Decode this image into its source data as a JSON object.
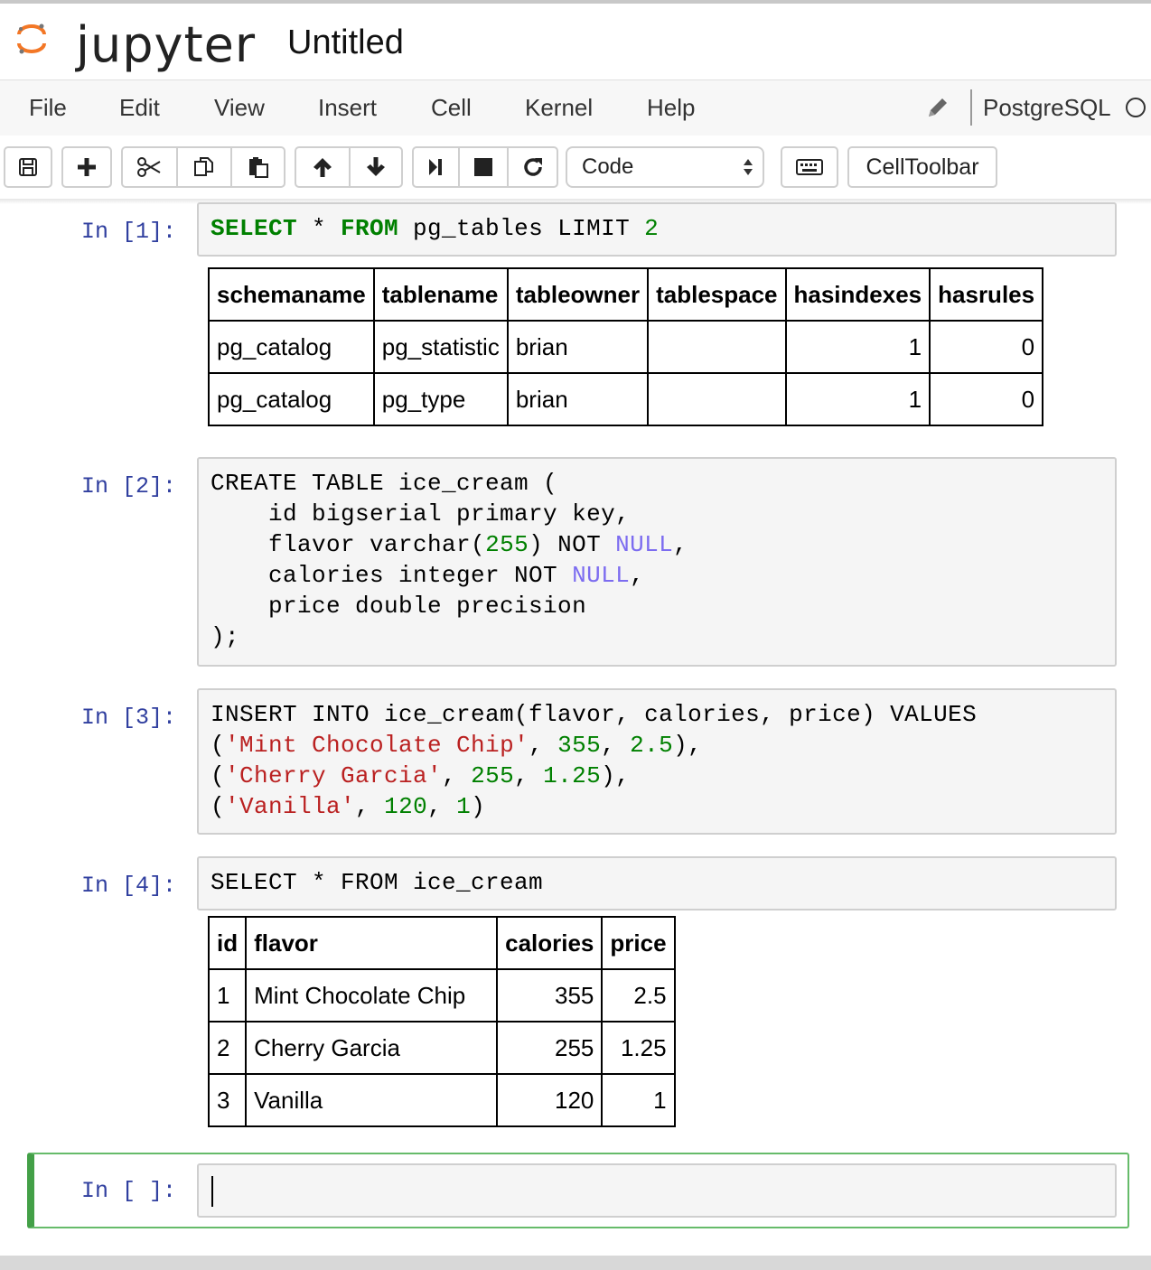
{
  "header": {
    "logo_text": "jupyter",
    "notebook_name": "Untitled"
  },
  "menubar": {
    "items": [
      "File",
      "Edit",
      "View",
      "Insert",
      "Cell",
      "Kernel",
      "Help"
    ],
    "kernel_name": "PostgreSQL",
    "edit_icon": "pencil-icon",
    "kernel_indicator_icon": "kernel-idle-circle-icon"
  },
  "toolbar": {
    "buttons": [
      "save-icon",
      "plus-icon",
      "cut-icon",
      "copy-icon",
      "paste-icon",
      "arrow-up-icon",
      "arrow-down-icon",
      "run-icon",
      "stop-icon",
      "restart-icon",
      "keyboard-icon"
    ],
    "cell_type": "Code",
    "celltoolbar_label": "CellToolbar"
  },
  "cells": [
    {
      "prompt": "In [1]:",
      "code": "SELECT * FROM pg_tables LIMIT 2",
      "output_table": {
        "columns": [
          "schemaname",
          "tablename",
          "tableowner",
          "tablespace",
          "hasindexes",
          "hasrules"
        ],
        "rows": [
          [
            "pg_catalog",
            "pg_statistic",
            "brian",
            "",
            "1",
            "0"
          ],
          [
            "pg_catalog",
            "pg_type",
            "brian",
            "",
            "1",
            "0"
          ]
        ]
      }
    },
    {
      "prompt": "In [2]:",
      "code": "CREATE TABLE ice_cream (\n    id bigserial primary key,\n    flavor varchar(255) NOT NULL,\n    calories integer NOT NULL,\n    price double precision\n);"
    },
    {
      "prompt": "In [3]:",
      "code": "INSERT INTO ice_cream(flavor, calories, price) VALUES\n('Mint Chocolate Chip', 355, 2.5),\n('Cherry Garcia', 255, 1.25),\n('Vanilla', 120, 1)"
    },
    {
      "prompt": "In [4]:",
      "code": "SELECT * FROM ice_cream",
      "output_table": {
        "columns": [
          "id",
          "flavor",
          "calories",
          "price"
        ],
        "rows": [
          [
            "1",
            "Mint Chocolate Chip",
            "355",
            "2.5"
          ],
          [
            "2",
            "Cherry Garcia",
            "255",
            "1.25"
          ],
          [
            "3",
            "Vanilla",
            "120",
            "1"
          ]
        ]
      }
    },
    {
      "prompt": "In [ ]:",
      "code": ""
    }
  ],
  "colors": {
    "prompt": "#303f9f",
    "keyword": "#008000",
    "string": "#ba2121",
    "null": "#7c6cf0",
    "selected_border": "#43a047"
  }
}
